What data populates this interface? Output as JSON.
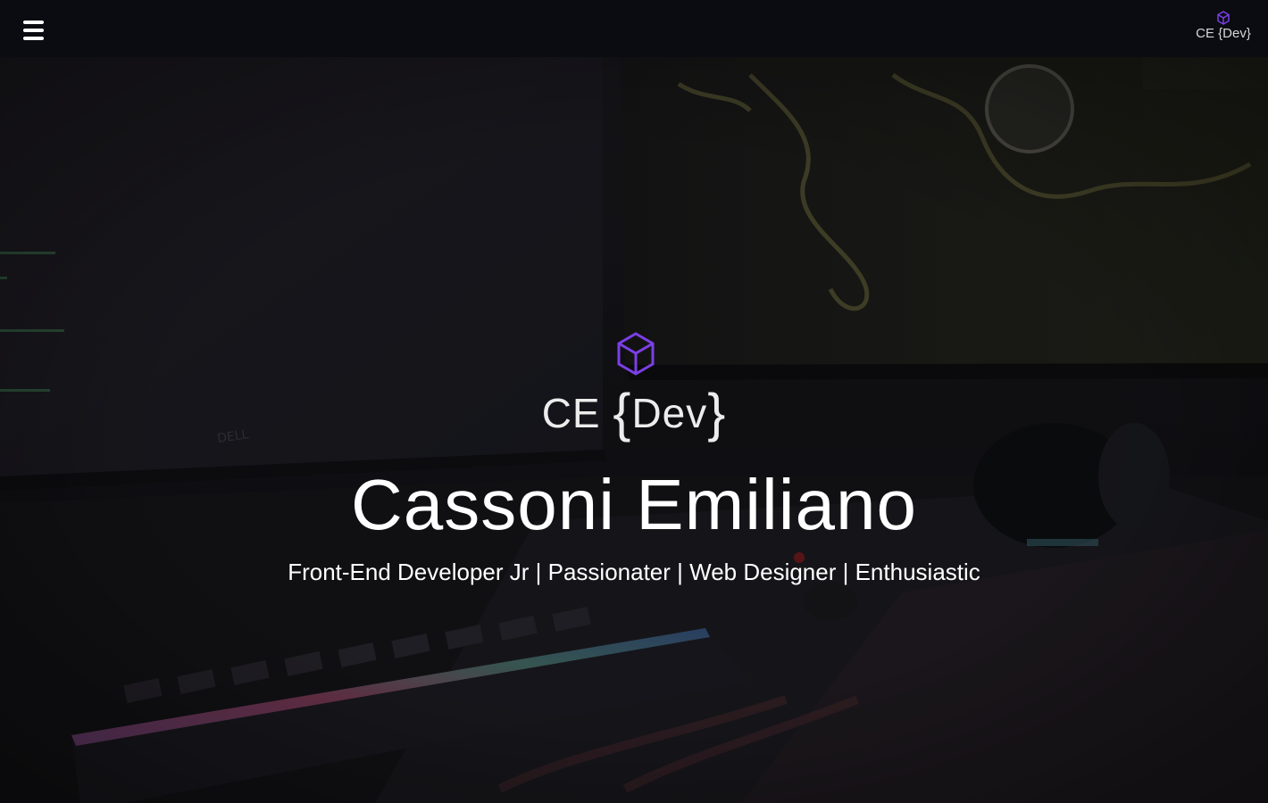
{
  "navbar": {
    "menu_icon": "hamburger-menu-icon",
    "logo": {
      "icon": "cube-icon",
      "text": "CE {Dev}"
    }
  },
  "hero": {
    "background": "photo of dark gaming desk with monitors, RGB keyboard and headphones",
    "logo": {
      "icon": "cube-icon",
      "prefix": "CE",
      "brace_open": "{",
      "word": "Dev",
      "brace_close": "}"
    },
    "name": "Cassoni Emiliano",
    "tagline": "Front-End Developer Jr | Passionater | Web Designer | Enthusiastic"
  },
  "colors": {
    "navbar_bg": "#0a0c12",
    "accent_purple": "#7b3fe4",
    "text_white": "#ffffff"
  }
}
